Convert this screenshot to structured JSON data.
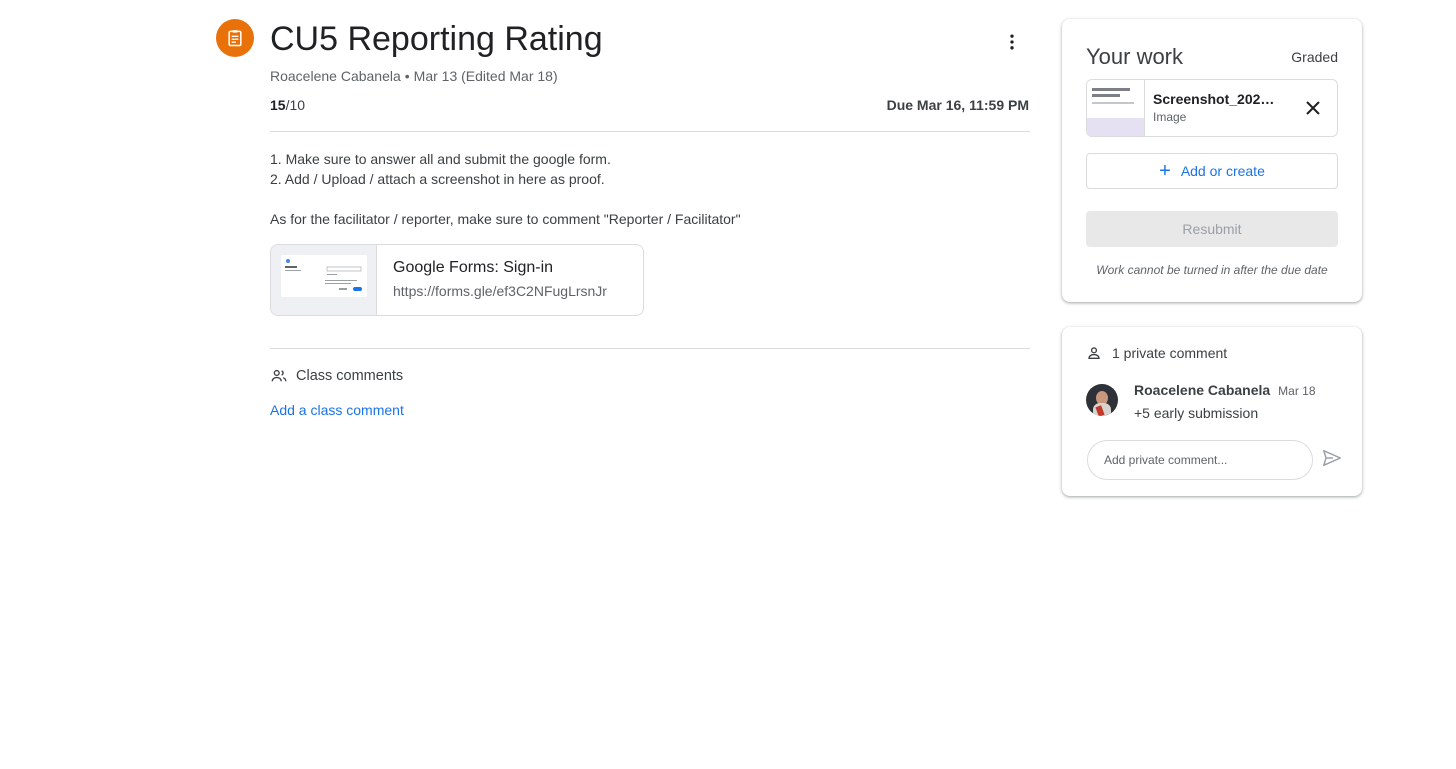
{
  "assignment": {
    "icon": "assignment-icon",
    "title": "CU5 Reporting Rating",
    "author": "Roacelene Cabanela",
    "separator": "•",
    "date_info": "Mar 13 (Edited Mar 18)",
    "points_earned": "15",
    "points_total": "/10",
    "due": "Due Mar 16, 11:59 PM",
    "more_icon": "more-vert-icon",
    "instructions": {
      "line1": "1. Make sure to answer all and submit the google form.",
      "line2": "2. Add / Upload / attach a screenshot in here as proof.",
      "line3": "As for the facilitator / reporter, make sure to comment \"Reporter / Facilitator\""
    },
    "attachment": {
      "title": "Google Forms: Sign-in",
      "url": "https://forms.gle/ef3C2NFugLrsnJr"
    }
  },
  "class_comments": {
    "icon": "people-icon",
    "label": "Class comments",
    "add_link": "Add a class comment"
  },
  "your_work": {
    "title": "Your work",
    "status": "Graded",
    "file": {
      "name": "Screenshot_2025...",
      "type": "Image",
      "thumb_title": "Reporting Rating 2024-2025",
      "remove_icon": "close-icon"
    },
    "add_button": {
      "icon": "plus-icon",
      "label": "Add or create"
    },
    "resubmit_label": "Resubmit",
    "note": "Work cannot be turned in after the due date"
  },
  "private_comments": {
    "icon": "person-icon",
    "header": "1 private comment",
    "comments": [
      {
        "author": "Roacelene Cabanela",
        "date": "Mar 18",
        "text": "+5 early submission"
      }
    ],
    "input_placeholder": "Add private comment...",
    "send_icon": "send-icon"
  },
  "colors": {
    "accent": "#1a73e8",
    "assignment_icon_bg": "#e8710a",
    "divider": "#dadce0"
  }
}
